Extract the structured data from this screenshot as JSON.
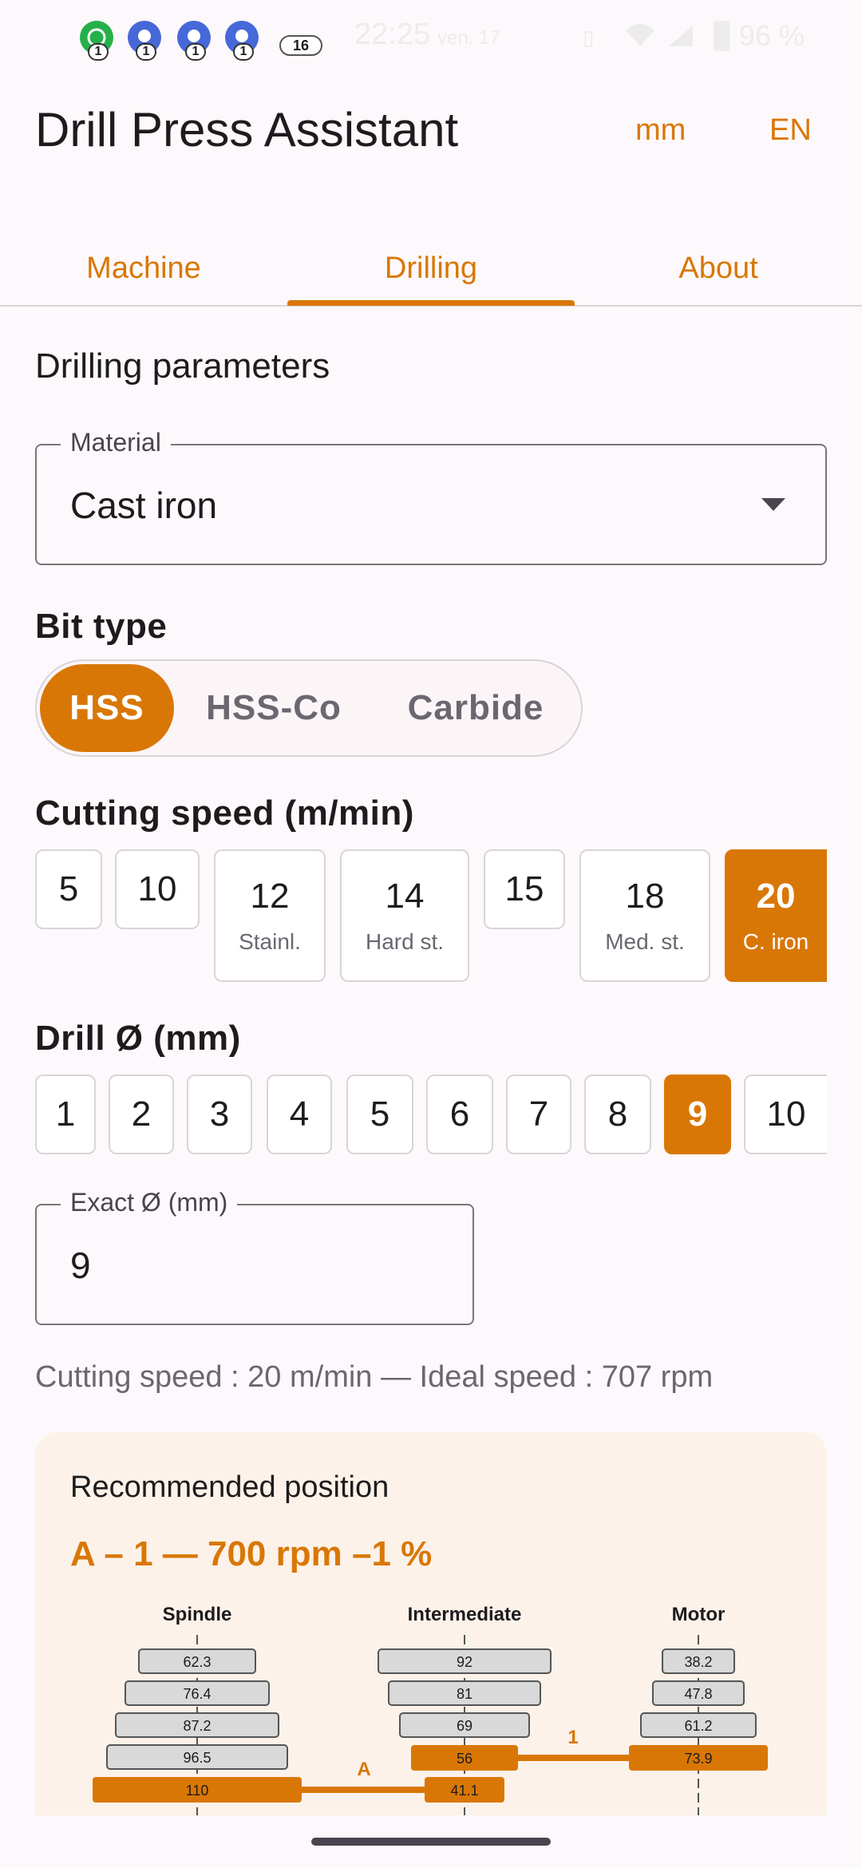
{
  "status_bar": {
    "notification_badges": [
      "1",
      "1",
      "1",
      "1"
    ],
    "overflow_badge": "16",
    "time": "22:25",
    "date": "ven. 17",
    "battery": "96 %"
  },
  "app_bar": {
    "title": "Drill Press Assistant",
    "unit_action": "mm",
    "language_action": "EN"
  },
  "tabs": [
    {
      "label": "Machine",
      "selected": false
    },
    {
      "label": "Drilling",
      "selected": true
    },
    {
      "label": "About",
      "selected": false
    }
  ],
  "drilling": {
    "section_title": "Drilling parameters",
    "material": {
      "label": "Material",
      "value": "Cast iron"
    },
    "bit_type": {
      "title": "Bit type",
      "options": [
        {
          "label": "HSS",
          "selected": true
        },
        {
          "label": "HSS-Co",
          "selected": false
        },
        {
          "label": "Carbide",
          "selected": false
        }
      ]
    },
    "cutting_speed": {
      "title": "Cutting speed (m/min)",
      "chips": [
        {
          "value": "5",
          "sub": "",
          "selected": false
        },
        {
          "value": "10",
          "sub": "",
          "selected": false
        },
        {
          "value": "12",
          "sub": "Stainl.",
          "selected": false
        },
        {
          "value": "14",
          "sub": "Hard st.",
          "selected": false
        },
        {
          "value": "15",
          "sub": "",
          "selected": false
        },
        {
          "value": "18",
          "sub": "Med. st.",
          "selected": false
        },
        {
          "value": "20",
          "sub": "C. iron",
          "selected": true
        }
      ]
    },
    "drill_diameter": {
      "title": "Drill Ø (mm)",
      "chips": [
        {
          "value": "1",
          "selected": false
        },
        {
          "value": "2",
          "selected": false
        },
        {
          "value": "3",
          "selected": false
        },
        {
          "value": "4",
          "selected": false
        },
        {
          "value": "5",
          "selected": false
        },
        {
          "value": "6",
          "selected": false
        },
        {
          "value": "7",
          "selected": false
        },
        {
          "value": "8",
          "selected": false
        },
        {
          "value": "9",
          "selected": true
        },
        {
          "value": "10",
          "selected": false
        }
      ]
    },
    "exact_diameter": {
      "label": "Exact Ø (mm)",
      "value": "9"
    },
    "info_line": "Cutting speed : 20 m/min — Ideal speed : 707 rpm"
  },
  "recommendation": {
    "title": "Recommended position",
    "headline": "A – 1 — 700 rpm –1 %",
    "pulley_diagram": {
      "columns": [
        {
          "label": "Spindle",
          "steps": [
            "62.3",
            "76.4",
            "87.2",
            "96.5",
            "110"
          ],
          "selected_step": "110"
        },
        {
          "label": "Intermediate",
          "steps": [
            "92",
            "81",
            "69",
            "56",
            "41.1"
          ],
          "selected_steps": [
            "56",
            "41.1"
          ]
        },
        {
          "label": "Motor",
          "steps": [
            "38.2",
            "47.8",
            "61.2",
            "73.9"
          ],
          "selected_step": "73.9"
        }
      ],
      "belt_labels": [
        "A",
        "1"
      ]
    }
  },
  "colors": {
    "accent": "#d97706",
    "background": "#fdf8fb",
    "card": "#fcf2e9",
    "pulley_fill": "#d9d9d9"
  }
}
